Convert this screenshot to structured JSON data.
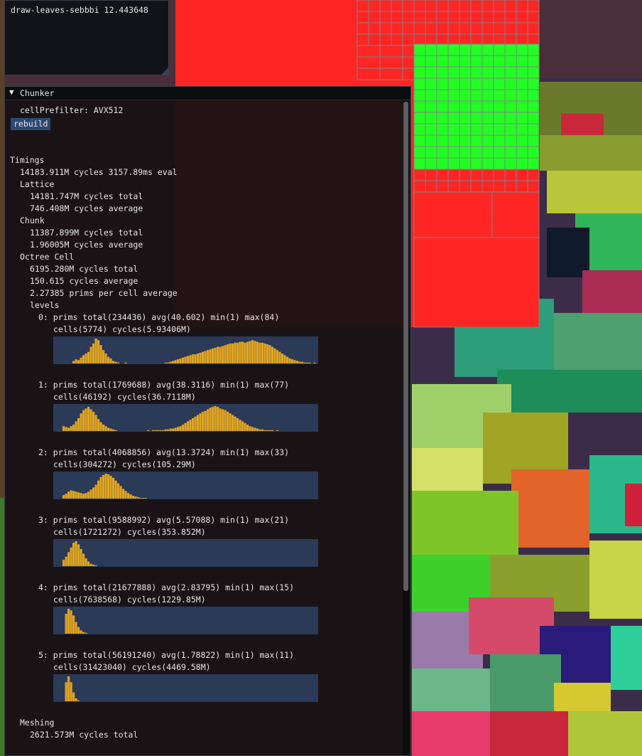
{
  "top_panel": {
    "text": "draw-leaves-sebbbi 12.443648"
  },
  "chunker": {
    "title": "Chunker",
    "cell_prefilter": "cellPrefilter: AVX512",
    "rebuild_label": "rebuild",
    "timings_label": "Timings",
    "eval_line": "14183.911M cycles 3157.89ms eval",
    "lattice": {
      "label": "Lattice",
      "total": "14181.747M cycles total",
      "average": "746.408M cycles average"
    },
    "chunk": {
      "label": "Chunk",
      "total": "11387.899M cycles total",
      "average": "1.96005M cycles average"
    },
    "octree_cell": {
      "label": "Octree Cell",
      "total": "6195.280M cycles total",
      "average": "150.615 cycles average",
      "prims_avg": "2.27385 prims per cell average"
    },
    "levels_label": "levels",
    "levels": [
      {
        "line1": "0: prims total(234436) avg(40.602) min(1) max(84)",
        "line2": "cells(5774) cycles(5.93406M)",
        "histogram": [
          0,
          0,
          0,
          0,
          0,
          0,
          0,
          0,
          0,
          0,
          0,
          0,
          0,
          0,
          0,
          0,
          0,
          0,
          0,
          0,
          0,
          0,
          0,
          0,
          0,
          0,
          0,
          0,
          0,
          0,
          0,
          0,
          0,
          0,
          0,
          0,
          0,
          0,
          0,
          0
        ]
      },
      {
        "line1": "1: prims total(1769688) avg(38.3116) min(1) max(77)",
        "line2": "cells(46192) cycles(36.7118M)",
        "histogram": []
      },
      {
        "line1": "2: prims total(4068856) avg(13.3724) min(1) max(33)",
        "line2": "cells(304272) cycles(105.29M)",
        "histogram": []
      },
      {
        "line1": "3: prims total(9588992) avg(5.57088) min(1) max(21)",
        "line2": "cells(1721272) cycles(353.852M)",
        "histogram": []
      },
      {
        "line1": "4: prims total(21677888) avg(2.83795) min(1) max(15)",
        "line2": "cells(7638568) cycles(1229.85M)",
        "histogram": []
      },
      {
        "line1": "5: prims total(56191240) avg(1.78822) min(1) max(11)",
        "line2": "cells(31423040) cycles(4469.58M)",
        "histogram": []
      }
    ],
    "meshing": {
      "label": "Meshing",
      "total": "2621.573M cycles total"
    }
  },
  "histograms": [
    [
      0,
      0,
      0,
      0,
      0,
      0,
      3,
      5,
      4,
      7,
      10,
      12,
      14,
      20,
      24,
      30,
      28,
      22,
      16,
      12,
      8,
      6,
      3,
      2,
      1,
      0,
      0,
      1,
      0,
      0,
      0,
      0,
      0,
      0,
      0,
      0,
      0,
      0,
      0,
      0,
      0,
      0,
      0,
      1,
      1,
      2,
      3,
      4,
      5,
      6,
      7,
      8,
      9,
      10,
      11,
      11,
      12,
      13,
      14,
      15,
      16,
      17,
      18,
      19,
      20,
      20,
      21,
      22,
      23,
      24,
      24,
      25,
      25,
      26,
      26,
      25,
      26,
      27,
      28,
      27,
      26,
      25,
      25,
      24,
      23,
      22,
      20,
      18,
      16,
      14,
      12,
      10,
      8,
      6,
      5,
      4,
      3,
      2,
      2,
      1,
      1,
      1,
      0,
      1,
      0
    ],
    [
      0,
      0,
      6,
      5,
      4,
      6,
      8,
      12,
      16,
      22,
      26,
      28,
      30,
      27,
      24,
      20,
      15,
      11,
      8,
      6,
      4,
      3,
      2,
      1,
      0,
      0,
      0,
      0,
      0,
      0,
      0,
      0,
      0,
      0,
      0,
      0,
      1,
      0,
      1,
      1,
      1,
      1,
      1,
      2,
      2,
      3,
      3,
      4,
      5,
      6,
      8,
      10,
      12,
      14,
      16,
      18,
      20,
      22,
      24,
      25,
      27,
      29,
      30,
      31,
      30,
      28,
      27,
      26,
      24,
      22,
      20,
      18,
      16,
      14,
      12,
      10,
      8,
      6,
      5,
      4,
      3,
      2,
      2,
      1,
      1,
      1,
      1,
      0,
      1,
      0
    ],
    [
      0,
      0,
      5,
      7,
      10,
      12,
      11,
      10,
      9,
      8,
      7,
      8,
      10,
      13,
      16,
      20,
      26,
      31,
      34,
      36,
      35,
      33,
      30,
      26,
      22,
      18,
      14,
      11,
      8,
      6,
      4,
      3,
      2,
      1,
      1,
      1,
      0,
      0,
      0,
      0
    ],
    [
      0,
      0,
      8,
      12,
      18,
      24,
      30,
      32,
      28,
      22,
      16,
      10,
      6,
      3,
      2,
      1
    ],
    [
      0,
      0,
      0,
      24,
      30,
      28,
      22,
      14,
      8,
      4,
      2,
      1
    ],
    [
      0,
      0,
      0,
      26,
      34,
      26,
      12,
      4,
      1
    ]
  ]
}
